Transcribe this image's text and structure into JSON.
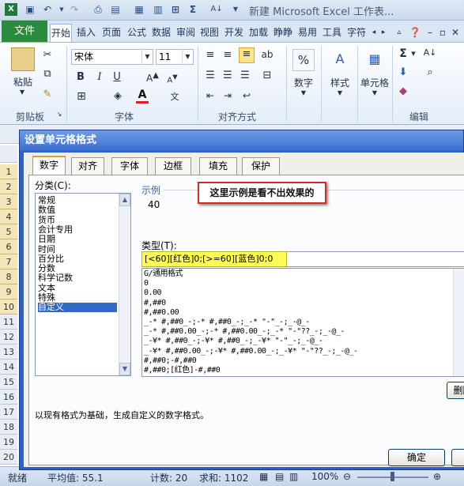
{
  "app": {
    "title": "新建 Microsoft Excel 工作表..."
  },
  "ribbon": {
    "file_tab": "文件",
    "tabs": [
      "开始",
      "插入",
      "页面",
      "公式",
      "数据",
      "审阅",
      "视图",
      "开发",
      "加载",
      "睁睁",
      "易用",
      "工具",
      "字符"
    ],
    "font_name": "宋体",
    "font_size": "11",
    "paste_label": "粘贴",
    "number_label": "数字",
    "style_label": "样式",
    "cells_label": "单元格",
    "groups": {
      "clipboard": "剪贴板",
      "font": "字体",
      "alignment": "对齐方式",
      "edit": "编辑"
    }
  },
  "sheet": {
    "row_headers": [
      "1",
      "2",
      "3",
      "4",
      "5",
      "6",
      "7",
      "8",
      "9",
      "10",
      "11",
      "12",
      "13",
      "14",
      "15",
      "16",
      "17",
      "18",
      "19",
      "20"
    ]
  },
  "statusbar": {
    "ready": "就绪",
    "average": "平均值: 55.1",
    "count": "计数: 20",
    "sum": "求和: 1102",
    "zoom": "100%"
  },
  "dialog": {
    "title": "设置单元格格式",
    "tabs": [
      "数字",
      "对齐",
      "字体",
      "边框",
      "填充",
      "保护"
    ],
    "category_label": "分类(C):",
    "categories": [
      "常规",
      "数值",
      "货币",
      "会计专用",
      "日期",
      "时间",
      "百分比",
      "分数",
      "科学记数",
      "文本",
      "特殊",
      "自定义"
    ],
    "selected_category": "自定义",
    "sample_label": "示例",
    "sample_value": "40",
    "callout": "这里示例是看不出效果的",
    "type_label": "类型(T):",
    "type_value": "[<60][红色]0;[>=60][蓝色]0;0",
    "formats": [
      "G/通用格式",
      "0",
      "0.00",
      "#,##0",
      "#,##0.00",
      "_-* #,##0_-;-* #,##0_-;_-* \"-\"_-;_-@_-",
      "_-* #,##0.00_-;-* #,##0.00_-;_-* \"-\"??_-;_-@_-",
      "_-¥* #,##0_-;-¥* #,##0_-;_-¥* \"-\"_-;_-@_-",
      "_-¥* #,##0.00_-;-¥* #,##0.00_-;_-¥* \"-\"??_-;_-@_-",
      "#,##0;-#,##0",
      "#,##0;[红色]-#,##0"
    ],
    "delete_button": "删除",
    "description": "以现有格式为基础，生成自定义的数字格式。",
    "ok_button": "确定",
    "cancel_button": "取消"
  }
}
